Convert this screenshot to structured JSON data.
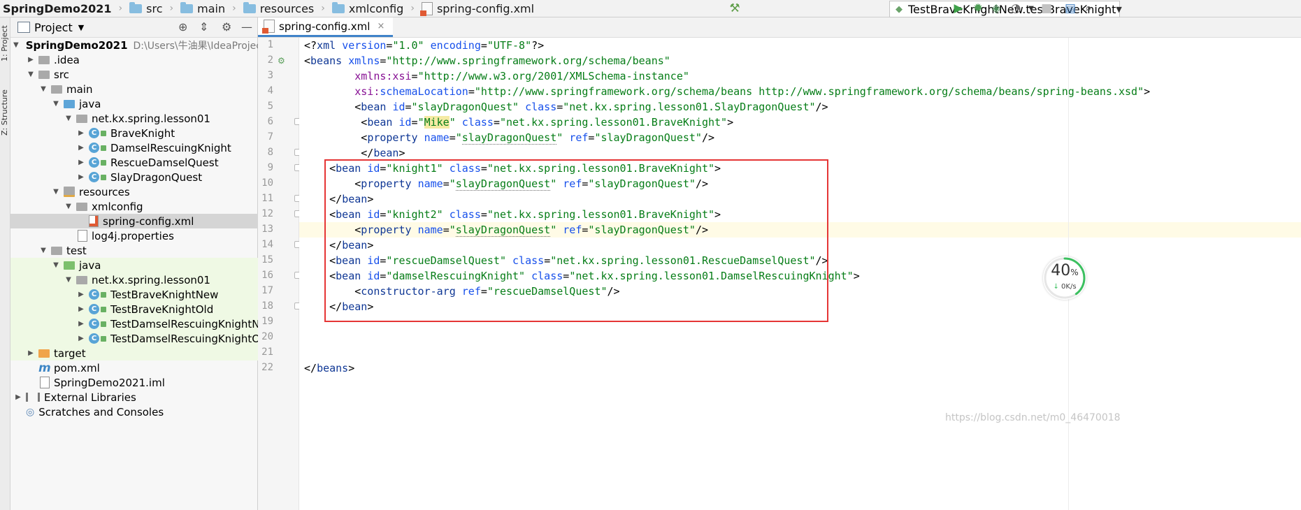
{
  "breadcrumb": [
    "SpringDemo2021",
    "src",
    "main",
    "resources",
    "xmlconfig",
    "spring-config.xml"
  ],
  "toolbar": {
    "run_config": "TestBraveKnightNew.testBraveKnight",
    "build_icon": "hammer-icon",
    "run_icon": "play-icon",
    "debug_icon": "bug-icon",
    "coverage_icon": "shield-icon",
    "profile_icon": "gauge-icon",
    "stop_icon": "stop-icon",
    "structure_icon": "folder-tree-icon"
  },
  "tool_strip": {
    "project_tab": "1: Project",
    "structure_tab": "Z: Structure"
  },
  "project_panel": {
    "title": "Project",
    "root_path": "D:\\Users\\牛油果\\IdeaProjects\\Sp",
    "items": [
      {
        "label": "SpringDemo2021"
      },
      {
        "label": ".idea"
      },
      {
        "label": "src"
      },
      {
        "label": "main"
      },
      {
        "label": "java"
      },
      {
        "label": "net.kx.spring.lesson01"
      },
      {
        "label": "BraveKnight"
      },
      {
        "label": "DamselRescuingKnight"
      },
      {
        "label": "RescueDamselQuest"
      },
      {
        "label": "SlayDragonQuest"
      },
      {
        "label": "resources"
      },
      {
        "label": "xmlconfig"
      },
      {
        "label": "spring-config.xml"
      },
      {
        "label": "log4j.properties"
      },
      {
        "label": "test"
      },
      {
        "label": "java"
      },
      {
        "label": "net.kx.spring.lesson01"
      },
      {
        "label": "TestBraveKnightNew"
      },
      {
        "label": "TestBraveKnightOld"
      },
      {
        "label": "TestDamselRescuingKnightNew"
      },
      {
        "label": "TestDamselRescuingKnightOld"
      },
      {
        "label": "target"
      },
      {
        "label": "pom.xml"
      },
      {
        "label": "SpringDemo2021.iml"
      },
      {
        "label": "External Libraries"
      },
      {
        "label": "Scratches and Consoles"
      }
    ]
  },
  "editor": {
    "tab_label": "spring-config.xml",
    "line_numbers": [
      "1",
      "2",
      "3",
      "4",
      "5",
      "6",
      "7",
      "8",
      "9",
      "10",
      "11",
      "12",
      "13",
      "14",
      "15",
      "16",
      "17",
      "18",
      "19",
      "20",
      "21",
      "22"
    ]
  },
  "meter": {
    "percent": "40",
    "unit": "%",
    "speed": "0K/s",
    "fraction": 0.4,
    "color": "#3cc060"
  },
  "watermark": "https://blog.csdn.net/m0_46470018"
}
